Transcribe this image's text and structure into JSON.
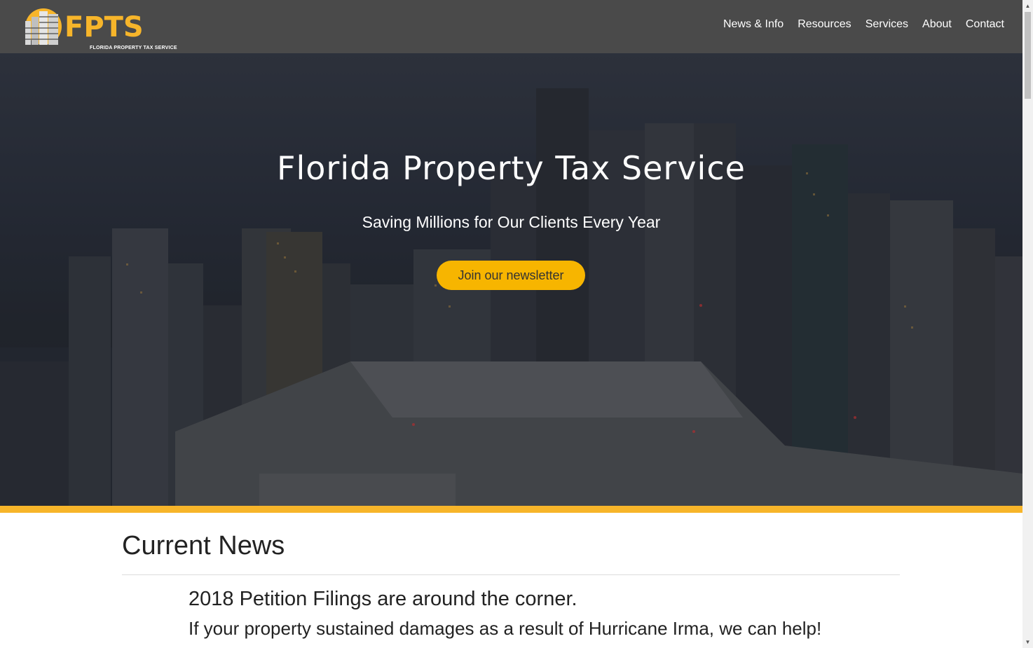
{
  "brand": {
    "name": "FPTS",
    "tagline": "FLORIDA PROPERTY TAX SERVICE",
    "accent_color": "#f7b52a",
    "nav_bg": "#4a4a4a"
  },
  "nav": {
    "items": [
      {
        "label": "News & Info"
      },
      {
        "label": "Resources"
      },
      {
        "label": "Services"
      },
      {
        "label": "About"
      },
      {
        "label": "Contact"
      }
    ]
  },
  "hero": {
    "title": "Florida Property Tax Service",
    "subtitle": "Saving Millions for Our Clients Every Year",
    "cta_label": "Join our newsletter",
    "cta_color": "#f7b500"
  },
  "news": {
    "heading": "Current News",
    "items": [
      {
        "title": "2018 Petition Filings are around the corner.",
        "body": "If your property sustained damages as a result of Hurricane Irma, we can help!"
      }
    ]
  },
  "icons": {
    "logo": "building-logo-icon",
    "scroll_up": "chevron-up-icon",
    "scroll_down": "chevron-down-icon"
  }
}
